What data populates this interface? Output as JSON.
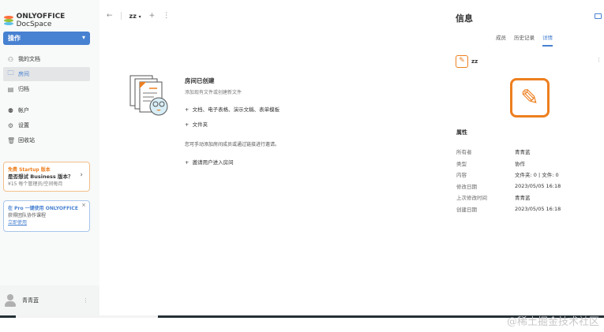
{
  "app": {
    "logo_text_bold": "ONLYOFFICE",
    "logo_text": "DocSpace"
  },
  "sidebar": {
    "action_label": "操作",
    "items": [
      {
        "label": "我的文档",
        "icon": "user-icon"
      },
      {
        "label": "房间",
        "icon": "folder-icon"
      },
      {
        "label": "归档",
        "icon": "archive-icon"
      },
      {
        "label": "帐户",
        "icon": "accounts-icon"
      },
      {
        "label": "设置",
        "icon": "gear-icon"
      },
      {
        "label": "回收站",
        "icon": "trash-icon"
      }
    ],
    "promo": {
      "tag": "免费 Startup 版本",
      "title": "是否想试 Business 版本？",
      "desc": "¥15 每个管理员/空间每月"
    },
    "pro": {
      "title": "在 Pro 一键使用 ONLYOFFICE",
      "desc": "获得团队协作课程",
      "link": "立即使用"
    },
    "user_name": "青青蓝"
  },
  "header": {
    "room_title": "zz"
  },
  "empty": {
    "title": "房间已创建",
    "subtitle": "添加现有文件或创建新文件",
    "action1": "文档、电子表格、演示文稿、表单模板",
    "action2": "文件夹",
    "hint": "您可手动添加房间成员或通过链接进行邀请。",
    "action3": "邀请用户进入房间"
  },
  "info": {
    "title": "信息",
    "tabs": [
      "成员",
      "历史记录",
      "详情"
    ],
    "room_name": "zz",
    "props_title": "属性",
    "props": [
      {
        "k": "所有者",
        "v": "青青蓝"
      },
      {
        "k": "类型",
        "v": "协作"
      },
      {
        "k": "内容",
        "v": "文件夹: 0 | 文件: 0"
      },
      {
        "k": "修改日期",
        "v": "2023/05/05 16:18"
      },
      {
        "k": "上次修改时间",
        "v": "青青蓝"
      },
      {
        "k": "创建日期",
        "v": "2023/05/05 16:18"
      }
    ]
  },
  "watermark": "@稀土掘金技术社区",
  "colors": {
    "accent": "#4781d1",
    "orange": "#ed7f1f"
  }
}
